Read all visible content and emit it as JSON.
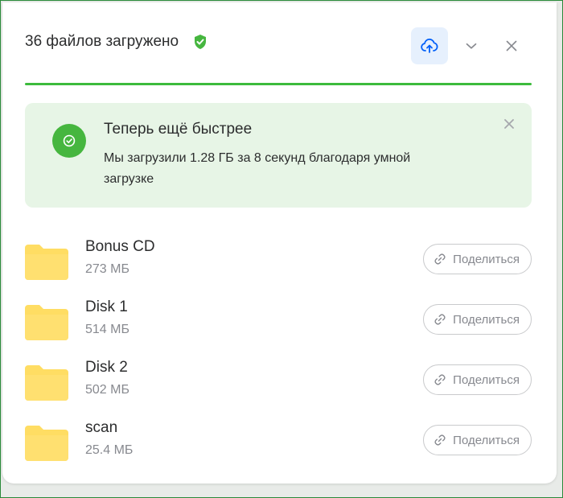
{
  "header": {
    "title": "36 файлов загружено",
    "icons": {
      "shield": "shield-check-icon",
      "upload": "cloud-upload-icon",
      "collapse": "chevron-down-icon",
      "close": "close-icon"
    }
  },
  "progress": {
    "percent": 100,
    "color": "#3cbb3c"
  },
  "notice": {
    "title": "Теперь ещё быстрее",
    "text": "Мы загрузили 1.28 ГБ за 8 секунд благодаря умной загрузке",
    "icon": "check-circle-icon",
    "close_icon": "close-icon",
    "background": "#e7f5e6",
    "accent": "#46b63f"
  },
  "share_label": "Поделиться",
  "files": [
    {
      "name": "Bonus CD",
      "size": "273 МБ"
    },
    {
      "name": "Disk 1",
      "size": "514 МБ"
    },
    {
      "name": "Disk 2",
      "size": "502 МБ"
    },
    {
      "name": "scan",
      "size": "25.4 МБ"
    }
  ],
  "colors": {
    "accent_blue": "#005ff9",
    "folder": "#ffdd63",
    "text_primary": "#2c2d2e",
    "text_secondary": "#87898f"
  }
}
